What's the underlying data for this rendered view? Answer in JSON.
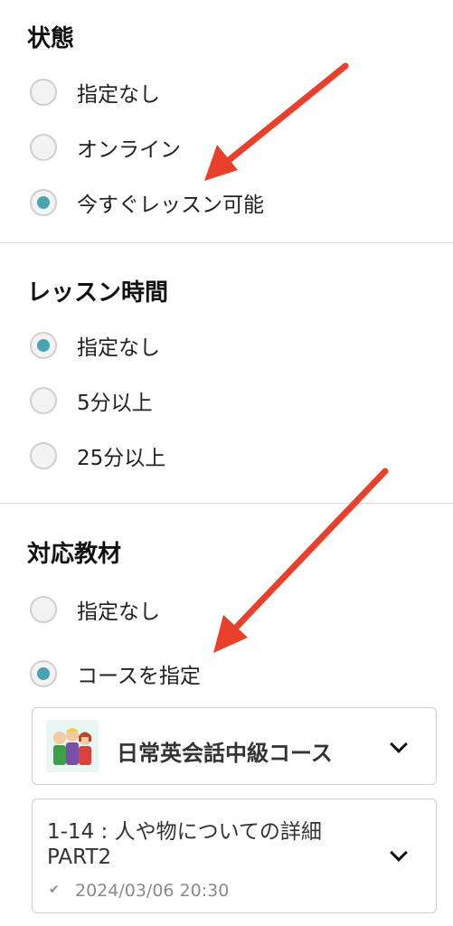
{
  "status": {
    "title": "状態",
    "options": [
      {
        "label": "指定なし",
        "checked": false
      },
      {
        "label": "オンライン",
        "checked": false
      },
      {
        "label": "今すぐレッスン可能",
        "checked": true
      }
    ]
  },
  "lesson_time": {
    "title": "レッスン時間",
    "options": [
      {
        "label": "指定なし",
        "checked": true
      },
      {
        "label": "5分以上",
        "checked": false
      },
      {
        "label": "25分以上",
        "checked": false
      }
    ]
  },
  "materials": {
    "title": "対応教材",
    "options": [
      {
        "label": "指定なし",
        "checked": false
      },
      {
        "label": "コースを指定",
        "checked": true
      }
    ],
    "course_select": {
      "label": "日常英会話中級コース",
      "icon": "chevron-down-icon"
    },
    "lesson_select": {
      "line1": "1-14 : 人や物についての詳細",
      "line2": "PART2",
      "date": "2024/03/06 20:30",
      "icon": "chevron-down-icon"
    }
  },
  "colors": {
    "accent": "#4aa3b0",
    "arrow": "#e8402b"
  }
}
